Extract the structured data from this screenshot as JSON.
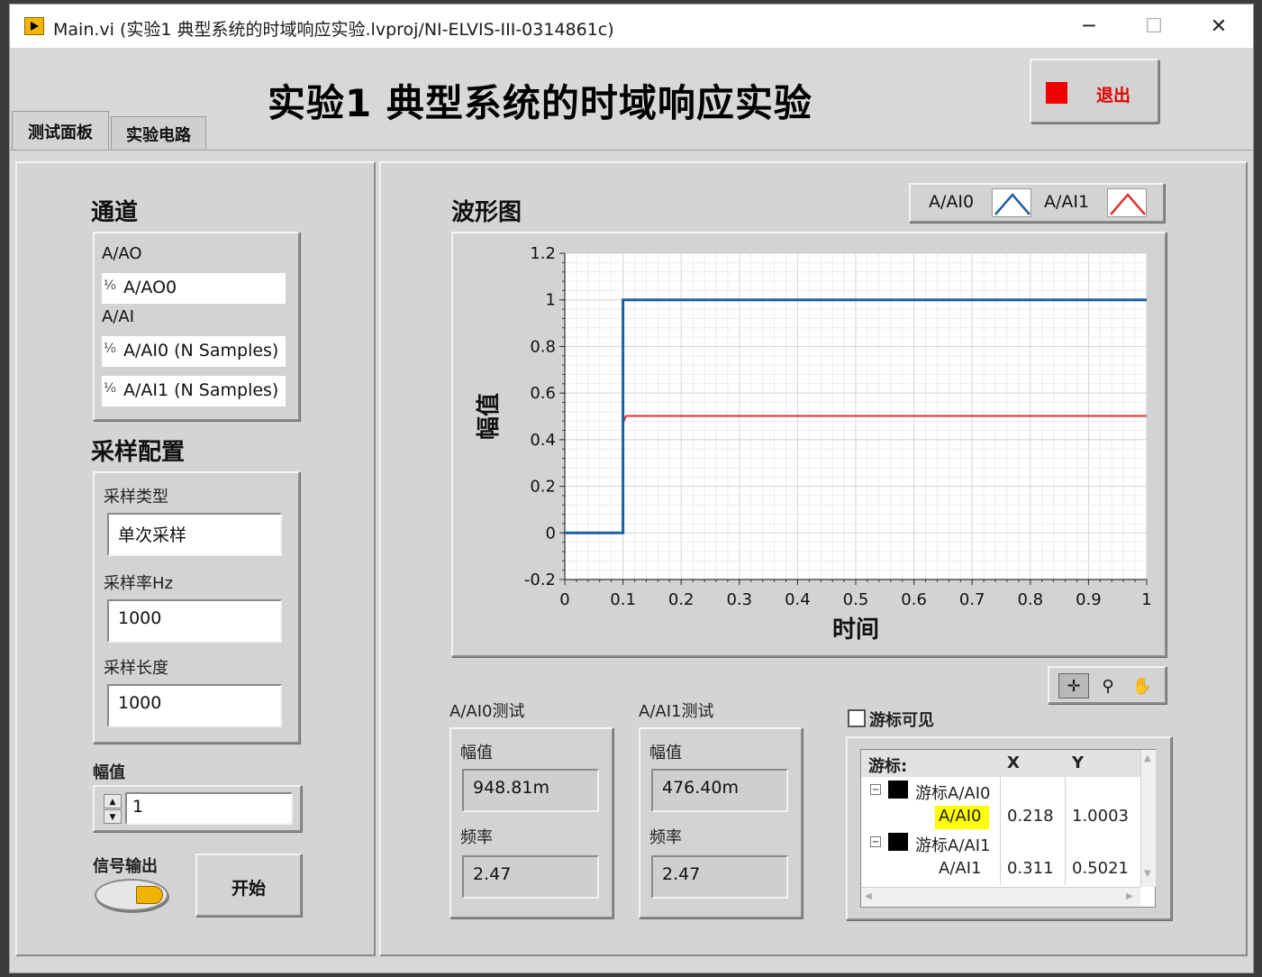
{
  "window": {
    "title": "Main.vi  (实验1 典型系统的时域响应实验.lvproj/NI-ELVIS-III-0314861c)",
    "minimize_glyph": "─",
    "maximize_glyph": "☐",
    "close_glyph": "✕"
  },
  "header": {
    "title": "实验1 典型系统的时域响应实验",
    "exit_label": "退出"
  },
  "tabs": [
    {
      "label": "测试面板",
      "active": true
    },
    {
      "label": "实验电路",
      "active": false
    }
  ],
  "channels": {
    "title": "通道",
    "ao_group": "A/AO",
    "ao_item": "A/AO0",
    "ai_group": "A/AI",
    "ai_items": [
      "A/AI0 (N Samples)",
      "A/AI1 (N Samples)"
    ],
    "io_glyph": "⅟₀"
  },
  "sampling": {
    "title": "采样配置",
    "type_label": "采样类型",
    "type_value": "单次采样",
    "rate_label": "采样率Hz",
    "rate_value": "1000",
    "length_label": "采样长度",
    "length_value": "1000"
  },
  "amplitude": {
    "label": "幅值",
    "value": "1"
  },
  "signal_output": {
    "label": "信号输出",
    "on": true
  },
  "start_label": "开始",
  "graph": {
    "title": "波形图",
    "legend": [
      {
        "name": "A/AI0",
        "color": "#1f5fa0"
      },
      {
        "name": "A/AI1",
        "color": "#e03030"
      }
    ]
  },
  "chart_data": {
    "type": "line",
    "xlabel": "时间",
    "ylabel": "幅值",
    "xlim": [
      0,
      1
    ],
    "ylim": [
      -0.2,
      1.2
    ],
    "x_ticks": [
      "0",
      "0.1",
      "0.2",
      "0.3",
      "0.4",
      "0.5",
      "0.6",
      "0.7",
      "0.8",
      "0.9",
      "1"
    ],
    "y_ticks": [
      "-0.2",
      "0",
      "0.2",
      "0.4",
      "0.6",
      "0.8",
      "1",
      "1.2"
    ],
    "grid": true,
    "series": [
      {
        "name": "A/AI0",
        "color": "#1f5fa0",
        "x": [
          0,
          0.1,
          0.1,
          1
        ],
        "y": [
          0,
          0,
          1.0,
          1.0
        ]
      },
      {
        "name": "A/AI1",
        "color": "#e03030",
        "x": [
          0,
          0.1,
          0.1,
          0.105,
          1
        ],
        "y": [
          0,
          0,
          0.47,
          0.5021,
          0.5021
        ]
      }
    ]
  },
  "ai0_test": {
    "title": "A/AI0测试",
    "amp_label": "幅值",
    "amp_value": "948.81m",
    "freq_label": "频率",
    "freq_value": "2.47"
  },
  "ai1_test": {
    "title": "A/AI1测试",
    "amp_label": "幅值",
    "amp_value": "476.40m",
    "freq_label": "频率",
    "freq_value": "2.47"
  },
  "cursor": {
    "visible_label": "游标可见",
    "visible_checked": false,
    "col_cursor": "游标:",
    "col_x": "X",
    "col_y": "Y",
    "rows": [
      {
        "name": "游标A/AI0",
        "channel": "A/AI0",
        "x": "0.218",
        "y": "1.0003",
        "highlight": true
      },
      {
        "name": "游标A/AI1",
        "channel": "A/AI1",
        "x": "0.311",
        "y": "0.5021",
        "highlight": false
      }
    ]
  },
  "palette_tools": [
    "crosshair-tool",
    "zoom-tool",
    "pan-tool"
  ]
}
